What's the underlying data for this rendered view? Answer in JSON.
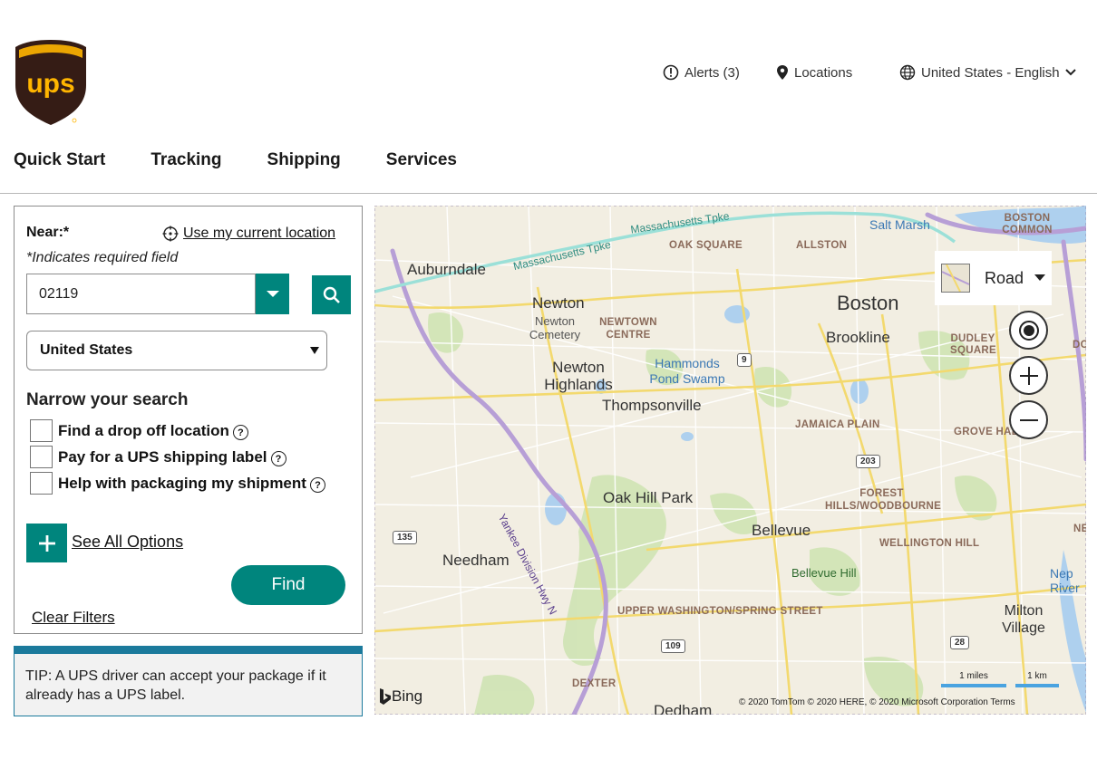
{
  "header": {
    "logo_text": "ups",
    "alerts_label": "Alerts (3)",
    "locations_label": "Locations",
    "language_label": "United States - English"
  },
  "nav": {
    "items": [
      "Quick Start",
      "Tracking",
      "Shipping",
      "Services"
    ]
  },
  "search": {
    "near_label": "Near:*",
    "use_location_label": "Use my current location",
    "required_note": "*Indicates required field",
    "zip_value": "02119",
    "country_value": "United States",
    "narrow_heading": "Narrow your search",
    "options": [
      {
        "label": "Find a drop off location",
        "checked": false
      },
      {
        "label": "Pay for a UPS shipping label",
        "checked": false
      },
      {
        "label": "Help with packaging my shipment",
        "checked": false
      }
    ],
    "help_glyph": "?",
    "see_all_label": "See All Options",
    "find_label": "Find",
    "clear_filters_label": "Clear Filters"
  },
  "tip": {
    "text": "TIP: A UPS driver can accept your package if it already has a UPS label."
  },
  "map": {
    "style_label": "Road",
    "bing_label": "Bing",
    "copyright": "© 2020 TomTom © 2020 HERE, © 2020 Microsoft Corporation  Terms",
    "scale_miles": "1 miles",
    "scale_km": "1 km",
    "labels": {
      "auburndale": "Auburndale",
      "newton": "Newton",
      "newton_cemetery": "Newton Cemetery",
      "newtown_centre": "NEWTOWN CENTRE",
      "newton_highlands": "Newton Highlands",
      "thompsonville": "Thompsonville",
      "hammonds": "Hammonds Pond Swamp",
      "oak_square": "OAK SQUARE",
      "allston": "ALLSTON",
      "boston": "Boston",
      "brookline": "Brookline",
      "salt_marsh": "Salt Marsh",
      "boston_common": "BOSTON COMMON",
      "dudley_square": "DUDLEY SQUARE",
      "jamaica_plain": "JAMAICA PLAIN",
      "grove_hall": "GROVE HAL",
      "oak_hill_park": "Oak Hill Park",
      "forest_hills": "FOREST HILLS/WOODBOURNE",
      "bellevue": "Bellevue",
      "bellevue_hill": "Bellevue Hill",
      "wellington_hill": "WELLINGTON HILL",
      "needham": "Needham",
      "upper_washington": "UPPER WASHINGTON/SPRING STREET",
      "milton_village": "Milton Village",
      "dexter": "DEXTER",
      "dedham": "Dedham",
      "mass_tpke_1": "Massachusetts Tpke",
      "mass_tpke_2": "Massachusetts Tpke",
      "yankee_div": "Yankee Division Hwy N",
      "neponset": "Nep River",
      "dor": "DOR",
      "nep": "NEPO"
    },
    "shields": {
      "r9": "9",
      "r203": "203",
      "r135": "135",
      "r109": "109",
      "r28": "28"
    }
  },
  "colors": {
    "ups_brown": "#351c15",
    "ups_gold": "#ffb500",
    "teal": "#00857d",
    "tip_border": "#1b7a9c"
  }
}
